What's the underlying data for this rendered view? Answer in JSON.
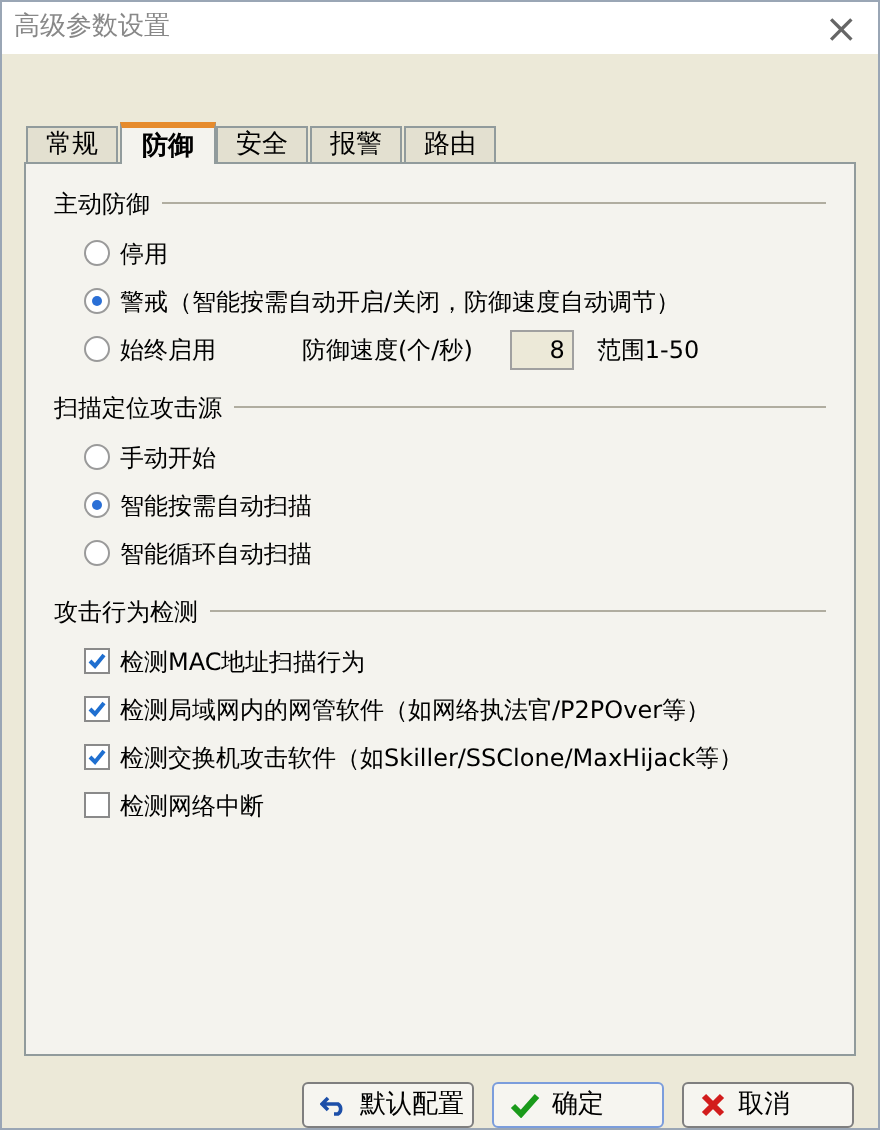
{
  "window": {
    "title": "高级参数设置",
    "close": "×"
  },
  "tabs": [
    {
      "label": "常规",
      "selected": false
    },
    {
      "label": "防御",
      "selected": true
    },
    {
      "label": "安全",
      "selected": false
    },
    {
      "label": "报警",
      "selected": false
    },
    {
      "label": "路由",
      "selected": false
    }
  ],
  "groups": [
    {
      "title": "主动防御",
      "options": [
        {
          "kind": "radio",
          "label": "停用",
          "selected": false
        },
        {
          "kind": "radio",
          "label": "警戒（智能按需自动开启/关闭，防御速度自动调节）",
          "selected": true
        },
        {
          "kind": "radio",
          "label": "始终启用",
          "selected": false,
          "speed_label": "防御速度(个/秒)",
          "speed_value": "8",
          "range": "范围1-50"
        }
      ]
    },
    {
      "title": "扫描定位攻击源",
      "options": [
        {
          "kind": "radio",
          "label": "手动开始",
          "selected": false
        },
        {
          "kind": "radio",
          "label": "智能按需自动扫描",
          "selected": true
        },
        {
          "kind": "radio",
          "label": "智能循环自动扫描",
          "selected": false
        }
      ]
    },
    {
      "title": "攻击行为检测",
      "options": [
        {
          "kind": "checkbox",
          "label": "检测MAC地址扫描行为",
          "checked": true
        },
        {
          "kind": "checkbox",
          "label": "检测局域网内的网管软件（如网络执法官/P2POver等）",
          "checked": true
        },
        {
          "kind": "checkbox",
          "label": "检测交换机攻击软件（如Skiller/SSClone/MaxHijack等）",
          "checked": true
        },
        {
          "kind": "checkbox",
          "label": "检测网络中断",
          "checked": false
        }
      ]
    }
  ],
  "buttons": [
    {
      "kind": "reset",
      "label": "默认配置"
    },
    {
      "kind": "ok",
      "label": "确定"
    },
    {
      "kind": "cancel",
      "label": "取消"
    }
  ]
}
